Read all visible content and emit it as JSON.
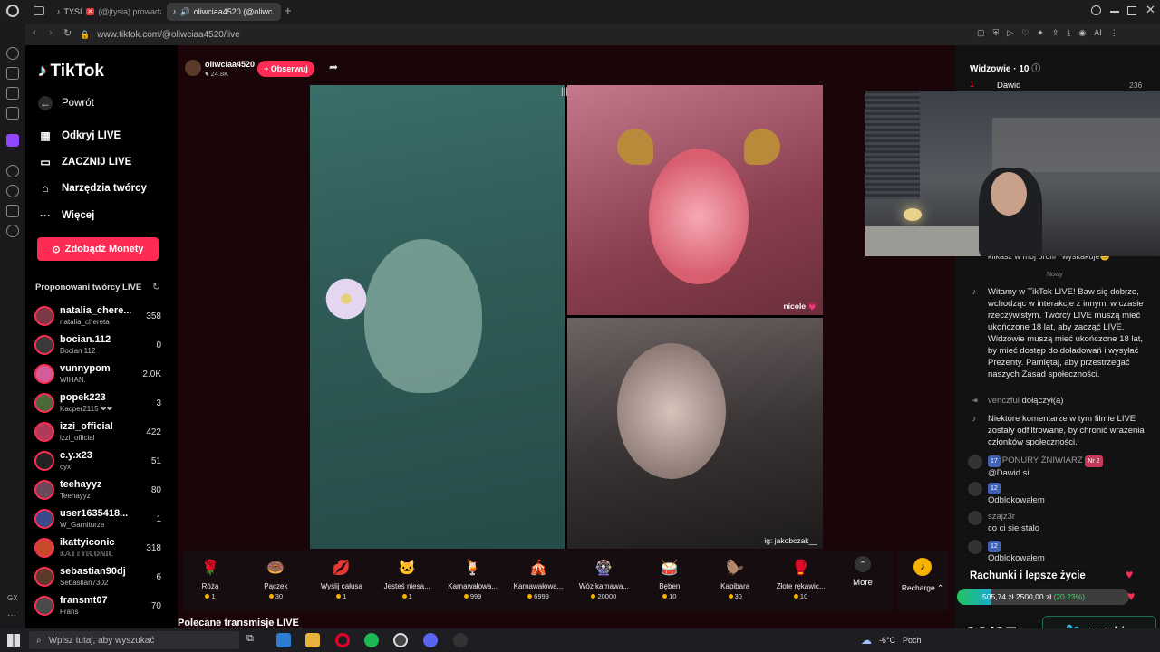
{
  "browser": {
    "tabs": [
      {
        "label": "TYSI",
        "extra": "(@jtysia) prowadz"
      },
      {
        "label": "oliwciaa4520 (@oliwc"
      }
    ],
    "url": "www.tiktok.com/@oliwciaa4520/live",
    "ai_label": "AI"
  },
  "tiktok": {
    "logo": "TikTok",
    "back": "Powrót",
    "nav": [
      "Odkryj LIVE",
      "ZACZNIJ LIVE",
      "Narzędzia twórcy",
      "Więcej"
    ],
    "coins_button": "Zdobądź Monety",
    "suggested_title": "Proponowani twórcy LIVE",
    "creators": [
      {
        "name": "natalia_chere...",
        "sub": "natalia_chereta",
        "count": "358"
      },
      {
        "name": "bocian.112",
        "sub": "Bocian 112",
        "count": "0"
      },
      {
        "name": "vunnypom",
        "sub": "WIHAN.",
        "count": "2.0K"
      },
      {
        "name": "popek223",
        "sub": "Kacper2115 ❤❤",
        "count": "3"
      },
      {
        "name": "izzi_official",
        "sub": "izzi_official",
        "count": "422"
      },
      {
        "name": "c.y.x23",
        "sub": "cyx",
        "count": "51"
      },
      {
        "name": "teehayyz",
        "sub": "Teehayyz",
        "count": "80"
      },
      {
        "name": "user1635418...",
        "sub": "W_Garniturze",
        "count": "1"
      },
      {
        "name": "ikattyiconic",
        "sub": "𝕂𝔸𝕋𝕋𝕐𝕀ℂ𝕆ℕ𝕀ℂ",
        "count": "318"
      },
      {
        "name": "sebastian90dj",
        "sub": "Sebastian7302",
        "count": "6"
      },
      {
        "name": "fransmt07",
        "sub": "Frans",
        "count": "70"
      }
    ]
  },
  "stream": {
    "host": "oliwciaa4520",
    "likes": "24.8K",
    "follow": "+ Obserwuj",
    "guest1_tag": "nicole 💗",
    "guest2_tag": "ig: jakobczak__",
    "recommended": "Polecane transmisje LIVE"
  },
  "gifts": [
    {
      "name": "Róża",
      "price": "1",
      "icon": "🌹"
    },
    {
      "name": "Pączek",
      "price": "30",
      "icon": "🍩"
    },
    {
      "name": "Wyślij całusa",
      "price": "1",
      "icon": "💋"
    },
    {
      "name": "Jesteś niesa...",
      "price": "1",
      "icon": "🐱"
    },
    {
      "name": "Karnawałowa...",
      "price": "999",
      "icon": "🍹"
    },
    {
      "name": "Karnawałowa...",
      "price": "6999",
      "icon": "🎪"
    },
    {
      "name": "Wóz karnawa...",
      "price": "20000",
      "icon": "🎡"
    },
    {
      "name": "Bęben",
      "price": "10",
      "icon": "🥁"
    },
    {
      "name": "Kapibara",
      "price": "30",
      "icon": "🦫"
    },
    {
      "name": "Złote rękawic...",
      "price": "10",
      "icon": "🥊"
    }
  ],
  "more_label": "More",
  "recharge_label": "Recharge",
  "chat": {
    "viewers_title": "Widzowie · 10",
    "top_viewer": {
      "rank": "1",
      "name": "Dawid",
      "score": "236"
    },
    "partial_line": "klikasz w mój profil i wyskakuje😊",
    "now_label": "Nowy",
    "messages": [
      {
        "type": "system",
        "text": "Witamy w TikTok LIVE! Baw się dobrze, wchodząc w interakcje z innymi w czasie rzeczywistym. Twórcy LIVE muszą mieć ukończone 18 lat, aby zacząć LIVE. Widzowie muszą mieć ukończone 18 lat, by mieć dostęp do doładowań i wysyłać Prezenty. Pamiętaj, aby przestrzegać naszych Zasad społeczności."
      },
      {
        "type": "join",
        "user": "venczful",
        "text": "dołączył(a)"
      },
      {
        "type": "system",
        "text": "Niektóre komentarze w tym filmie LIVE zostały odfiltrowane, by chronić wrażenia członków społeczności."
      },
      {
        "type": "user",
        "badge": "17",
        "user": "PONURY ŻNIWIARZ",
        "badge2": "Nr 2",
        "text": "@Dawid si"
      },
      {
        "type": "user",
        "badge": "12",
        "user": "",
        "text": "Odblokowałem"
      },
      {
        "type": "user",
        "badge": "",
        "user": "szajz3r",
        "text": "co ci sie stalo"
      },
      {
        "type": "user",
        "badge": "12",
        "user": "",
        "text": "Odblokowałem"
      }
    ]
  },
  "overlay": {
    "goal_title": "Rachunki i lepsze życie",
    "goal_current": "505,74 zł",
    "goal_target": "2500,00 zł",
    "goal_percent": "(20.23%)",
    "goal_progress": 0.2023,
    "timer": "23/25",
    "twitter": "venczful"
  },
  "taskbar": {
    "search_placeholder": "Wpisz tutaj, aby wyszukać",
    "weather": "-6°C",
    "weather_desc": "Poch"
  },
  "colors": {
    "accent": "#fe2c55",
    "coin": "#f5b300",
    "goal": "#22c55e"
  }
}
